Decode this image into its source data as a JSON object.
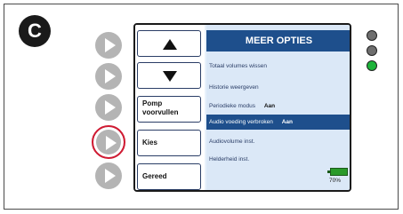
{
  "step": "C",
  "screen": {
    "title": "MEER OPTIES",
    "soft_keys": [
      {
        "label": "",
        "icon": "arrow-up-icon"
      },
      {
        "label": "",
        "icon": "arrow-down-icon"
      },
      {
        "label": "Pomp voorvullen"
      },
      {
        "label": "Kies"
      },
      {
        "label": "Gereed"
      }
    ],
    "menu_items": [
      {
        "label": "Totaal volumes wissen",
        "value": ""
      },
      {
        "label": "Historie weergeven",
        "value": ""
      },
      {
        "label": "Periodieke modus",
        "value": "Aan"
      },
      {
        "label": "Audio voeding verbroken",
        "value": "Aan"
      },
      {
        "label": "Audiovolume inst.",
        "value": ""
      },
      {
        "label": "Helderheid inst.",
        "value": ""
      }
    ],
    "selected_index": 3,
    "battery_percent": "70%"
  },
  "side_buttons": {
    "active_index": 3
  },
  "leds": [
    {
      "color": "#6e6e6e"
    },
    {
      "color": "#6e6e6e"
    },
    {
      "color": "#1db33a"
    }
  ],
  "colors": {
    "header": "#1e4f8c",
    "highlight": "#d01a32",
    "battery": "#2a9a2a"
  }
}
